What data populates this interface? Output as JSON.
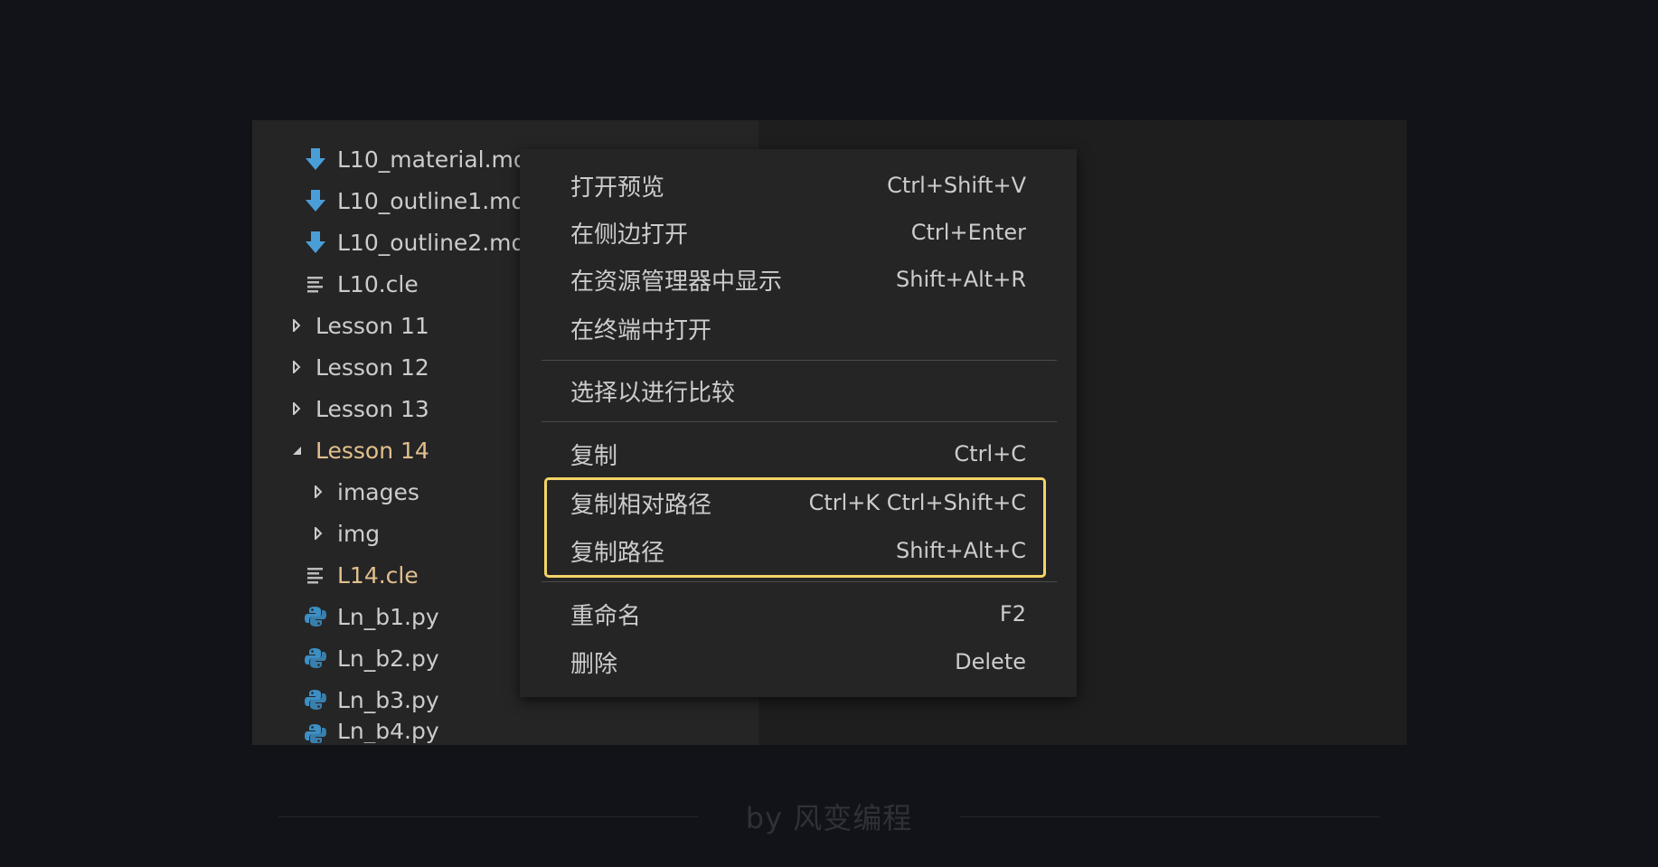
{
  "explorer": {
    "items": [
      {
        "label": "L10_material.md",
        "icon": "markdown-icon"
      },
      {
        "label": "L10_outline1.md",
        "icon": "markdown-icon"
      },
      {
        "label": "L10_outline2.md",
        "icon": "markdown-icon"
      },
      {
        "label": "L10.cle",
        "icon": "text-file-icon"
      },
      {
        "label": "Lesson 11",
        "icon": "chevron-right-icon"
      },
      {
        "label": "Lesson 12",
        "icon": "chevron-right-icon"
      },
      {
        "label": "Lesson 13",
        "icon": "chevron-right-icon"
      },
      {
        "label": "Lesson 14",
        "icon": "chevron-down-icon"
      },
      {
        "label": "images",
        "icon": "chevron-right-icon"
      },
      {
        "label": "img",
        "icon": "chevron-right-icon"
      },
      {
        "label": "L14.cle",
        "icon": "text-file-icon"
      },
      {
        "label": "Ln_b1.py",
        "icon": "python-icon"
      },
      {
        "label": "Ln_b2.py",
        "icon": "python-icon"
      },
      {
        "label": "Ln_b3.py",
        "icon": "python-icon"
      },
      {
        "label": "Ln_b4.py",
        "icon": "python-icon"
      }
    ]
  },
  "context_menu": {
    "items": [
      {
        "label": "打开预览",
        "shortcut": "Ctrl+Shift+V"
      },
      {
        "label": "在侧边打开",
        "shortcut": "Ctrl+Enter"
      },
      {
        "label": "在资源管理器中显示",
        "shortcut": "Shift+Alt+R"
      },
      {
        "label": "在终端中打开",
        "shortcut": ""
      },
      {
        "label": "选择以进行比较",
        "shortcut": ""
      },
      {
        "label": "复制",
        "shortcut": "Ctrl+C"
      },
      {
        "label": "复制相对路径",
        "shortcut": "Ctrl+K Ctrl+Shift+C"
      },
      {
        "label": "复制路径",
        "shortcut": "Shift+Alt+C"
      },
      {
        "label": "重命名",
        "shortcut": "F2"
      },
      {
        "label": "删除",
        "shortcut": "Delete"
      }
    ]
  },
  "footer": {
    "text": "by 风变编程"
  },
  "colors": {
    "highlight_border": "#f3d467",
    "active_file": "#e2c08d",
    "markdown_icon": "#4a9ed8",
    "python_icon": "#3d8fc4"
  }
}
